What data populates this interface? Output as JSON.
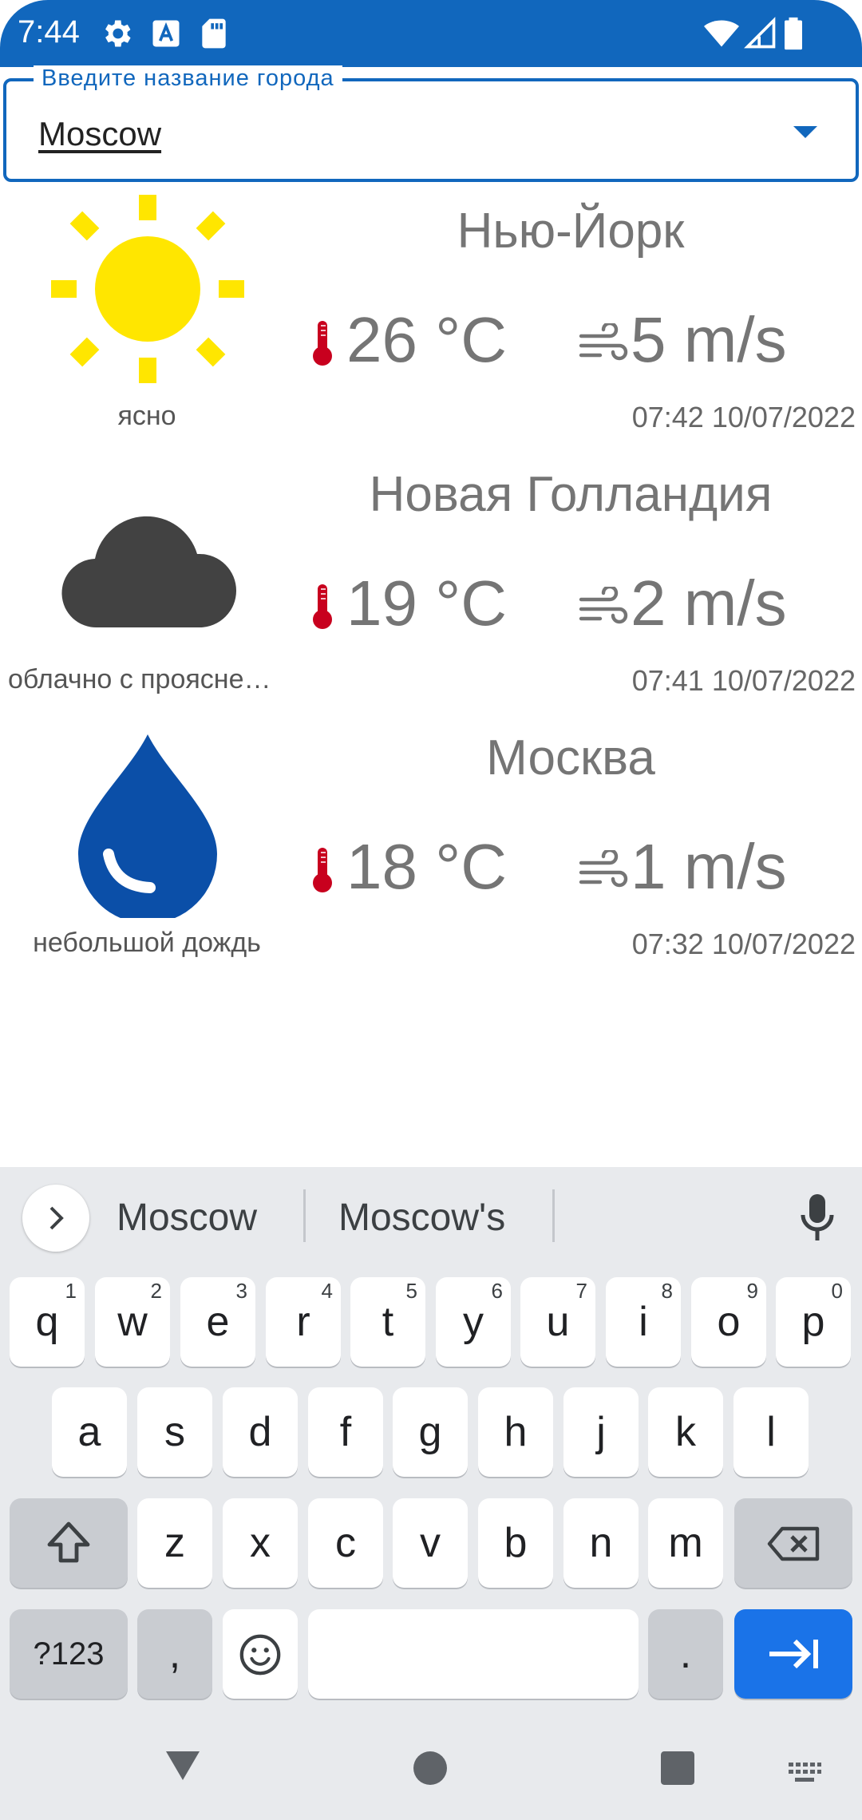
{
  "status_bar": {
    "time": "7:44",
    "icons": [
      "settings-icon",
      "text-a-icon",
      "sd-card-icon",
      "wifi-icon",
      "signal-icon",
      "battery-icon"
    ]
  },
  "search": {
    "label": "Введите название города",
    "value": "Moscow"
  },
  "weather": [
    {
      "city": "Нью-Йорк",
      "temperature": "26 °C",
      "wind": "5 m/s",
      "description": "ясно",
      "updated": "07:42 10/07/2022",
      "icon": "sun-icon"
    },
    {
      "city": "Новая Голландия",
      "temperature": "19 °C",
      "wind": "2 m/s",
      "description": "облачно с прояснениями",
      "updated": "07:41 10/07/2022",
      "icon": "cloud-icon"
    },
    {
      "city": "Москва",
      "temperature": "18 °C",
      "wind": "1 m/s",
      "description": "небольшой дождь",
      "updated": "07:32 10/07/2022",
      "icon": "raindrop-icon"
    }
  ],
  "keyboard": {
    "suggestions": [
      "Moscow",
      "Moscow's"
    ],
    "row1": [
      "q",
      "w",
      "e",
      "r",
      "t",
      "y",
      "u",
      "i",
      "o",
      "p"
    ],
    "row1_hints": [
      "1",
      "2",
      "3",
      "4",
      "5",
      "6",
      "7",
      "8",
      "9",
      "0"
    ],
    "row2": [
      "a",
      "s",
      "d",
      "f",
      "g",
      "h",
      "j",
      "k",
      "l"
    ],
    "row3": [
      "z",
      "x",
      "c",
      "v",
      "b",
      "n",
      "m"
    ],
    "symbols_label": "?123",
    "comma": ",",
    "period": "."
  },
  "colors": {
    "primary": "#1167bd",
    "sun": "#ffe600",
    "cloud": "#424242",
    "rain": "#0b4fa8",
    "thermometer": "#c8001e",
    "key_action": "#1a73e8"
  }
}
